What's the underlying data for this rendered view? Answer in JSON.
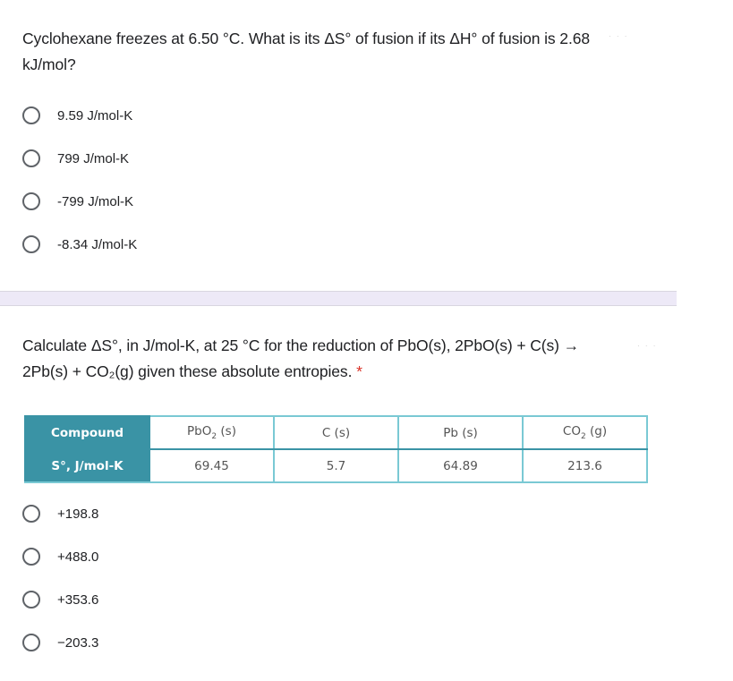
{
  "question1": {
    "text": "Cyclohexane freezes at 6.50 °C. What is its ΔS° of fusion if its ΔH° of fusion is 2.68 kJ/mol?",
    "options": [
      {
        "label": "9.59 J/mol-K",
        "selected": false
      },
      {
        "label": "799 J/mol-K",
        "selected": false
      },
      {
        "label": "-799 J/mol-K",
        "selected": false
      },
      {
        "label": "-8.34 J/mol-K",
        "selected": false
      }
    ]
  },
  "question2": {
    "text": "Calculate ΔS°, in J/mol-K, at 25 °C for the reduction of PbO(s), 2PbO(s) + C(s) → 2Pb(s) + CO₂(g) given these absolute entropies.",
    "required_marker": "*",
    "table": {
      "row_headers": [
        "Compound",
        "S°, J/mol-K"
      ],
      "compounds": [
        {
          "base": "PbO",
          "sub": "2",
          "phase": " (s)",
          "entropy": "69.45"
        },
        {
          "base": "C (s)",
          "sub": "",
          "phase": "",
          "entropy": "5.7"
        },
        {
          "base": "Pb (s)",
          "sub": "",
          "phase": "",
          "entropy": "64.89"
        },
        {
          "base": "CO",
          "sub": "2",
          "phase": " (g)",
          "entropy": "213.6"
        }
      ]
    },
    "options": [
      {
        "label": "+198.8",
        "selected": false
      },
      {
        "label": "+488.0",
        "selected": false
      },
      {
        "label": "+353.6",
        "selected": false
      },
      {
        "label": "−203.3",
        "selected": false
      }
    ]
  },
  "colors": {
    "table_header_bg": "#3a93a5",
    "table_border": "#7ac9d4",
    "separator_bg": "#ede9f7",
    "required_star": "#d93025"
  }
}
